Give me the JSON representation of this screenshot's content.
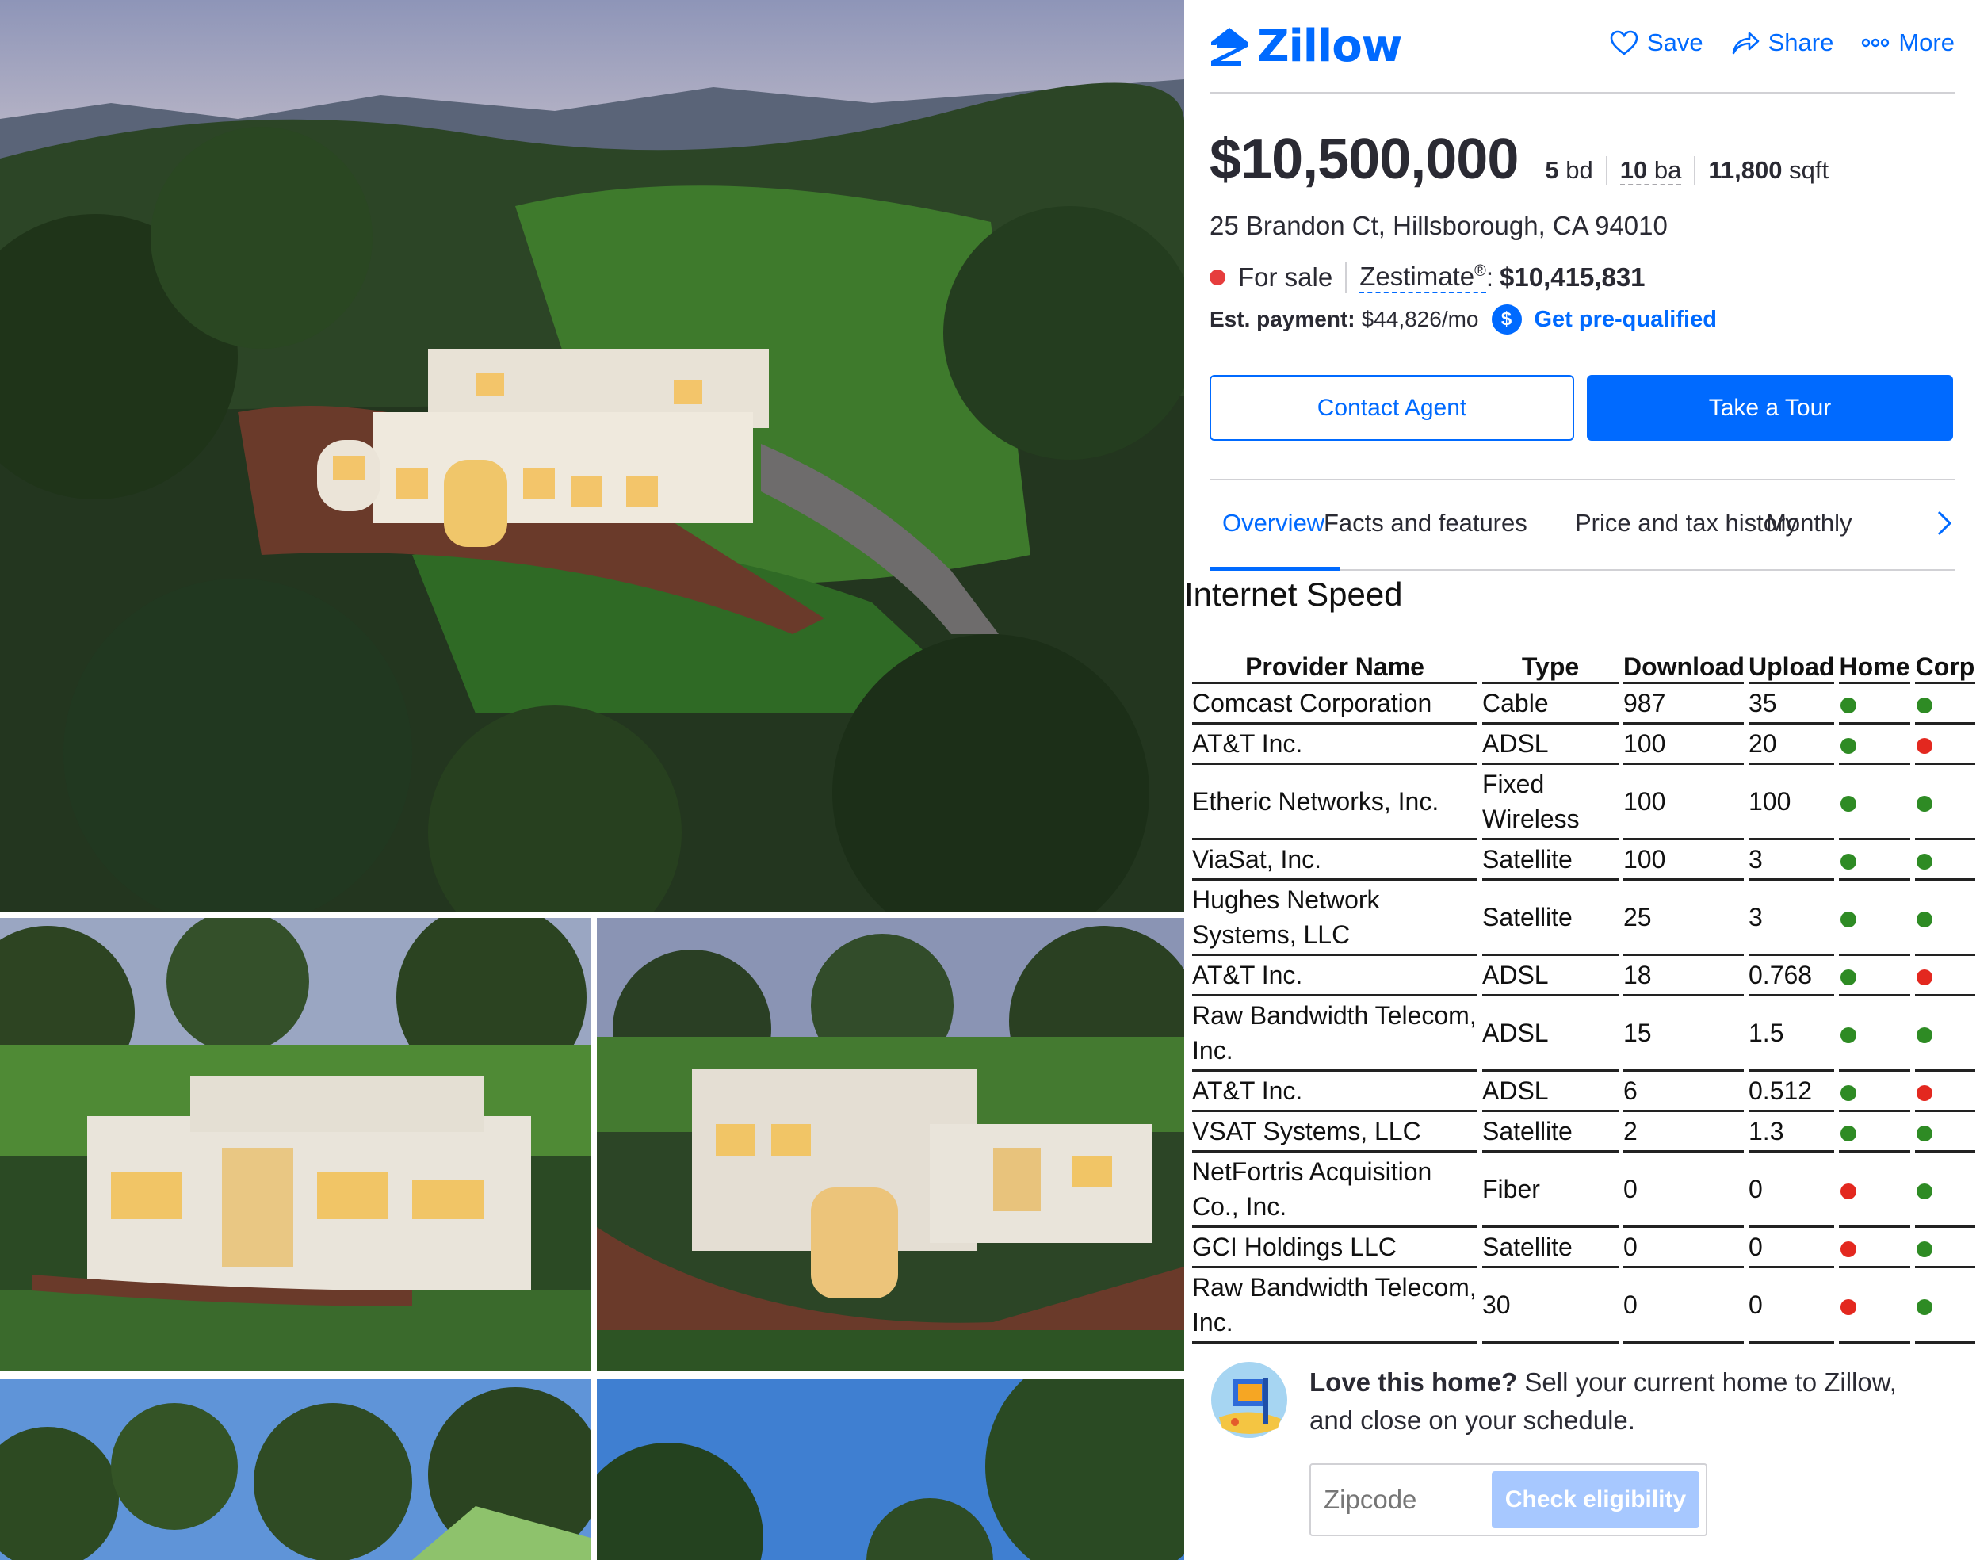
{
  "brand": {
    "name": "Zillow",
    "color": "#006aff",
    "logo_icon": "zillow-house-icon"
  },
  "header_actions": [
    {
      "label": "Save",
      "icon": "heart-icon"
    },
    {
      "label": "Share",
      "icon": "share-arrow-icon"
    },
    {
      "label": "More",
      "icon": "more-dots-icon"
    }
  ],
  "listing": {
    "price": "$10,500,000",
    "beds_num": "5",
    "beds_unit": "bd",
    "baths_num": "10",
    "baths_unit": "ba",
    "sqft_num": "11,800",
    "sqft_unit": "sqft",
    "address": "25 Brandon Ct, Hillsborough, CA 94010",
    "status": "For sale",
    "status_color": "#e63d3d",
    "zestimate_label": "Zestimate",
    "zestimate_sup": "®",
    "zestimate_sep": ":",
    "zestimate_value": "$10,415,831",
    "payment_label": "Est. payment:",
    "payment_value": "$44,826/mo",
    "prequal_icon_glyph": "$",
    "prequal_label": "Get pre-qualified"
  },
  "buttons": {
    "contact": "Contact Agent",
    "tour": "Take a Tour"
  },
  "tabs": [
    {
      "label": "Overview",
      "active": true
    },
    {
      "label": "Facts and features",
      "active": false
    },
    {
      "label": "Price and tax history",
      "active": false
    },
    {
      "label": "Monthly",
      "active": false
    }
  ],
  "internet": {
    "title": "Internet Speed",
    "columns": [
      "Provider Name",
      "Type",
      "Download",
      "Upload",
      "Home",
      "Corp"
    ],
    "rows": [
      {
        "provider": "Comcast Corporation",
        "type": "Cable",
        "download": "987",
        "upload": "35",
        "home": "green",
        "corp": "green"
      },
      {
        "provider": "AT&T Inc.",
        "type": "ADSL",
        "download": "100",
        "upload": "20",
        "home": "green",
        "corp": "red"
      },
      {
        "provider": "Etheric Networks, Inc.",
        "type": "Fixed Wireless",
        "download": "100",
        "upload": "100",
        "home": "green",
        "corp": "green"
      },
      {
        "provider": "ViaSat, Inc.",
        "type": "Satellite",
        "download": "100",
        "upload": "3",
        "home": "green",
        "corp": "green"
      },
      {
        "provider": "Hughes Network Systems, LLC",
        "type": "Satellite",
        "download": "25",
        "upload": "3",
        "home": "green",
        "corp": "green"
      },
      {
        "provider": "AT&T Inc.",
        "type": "ADSL",
        "download": "18",
        "upload": "0.768",
        "home": "green",
        "corp": "red"
      },
      {
        "provider": "Raw Bandwidth Telecom, Inc.",
        "type": "ADSL",
        "download": "15",
        "upload": "1.5",
        "home": "green",
        "corp": "green"
      },
      {
        "provider": "AT&T Inc.",
        "type": "ADSL",
        "download": "6",
        "upload": "0.512",
        "home": "green",
        "corp": "red"
      },
      {
        "provider": "VSAT Systems, LLC",
        "type": "Satellite",
        "download": "2",
        "upload": "1.3",
        "home": "green",
        "corp": "green"
      },
      {
        "provider": "NetFortris Acquisition Co., Inc.",
        "type": "Fiber",
        "download": "0",
        "upload": "0",
        "home": "red",
        "corp": "green"
      },
      {
        "provider": "GCI Holdings LLC",
        "type": "Satellite",
        "download": "0",
        "upload": "0",
        "home": "red",
        "corp": "green"
      },
      {
        "provider": "Raw Bandwidth Telecom, Inc.",
        "type": "30",
        "download": "0",
        "upload": "0",
        "home": "red",
        "corp": "green"
      }
    ]
  },
  "sell": {
    "headline": "Love this home?",
    "body": " Sell your current home to Zillow, and close on your schedule.",
    "zip_placeholder": "Zipcode",
    "check_label": "Check eligibility"
  },
  "colors": {
    "status_green": "#2e8b24",
    "status_red": "#e3281f"
  }
}
